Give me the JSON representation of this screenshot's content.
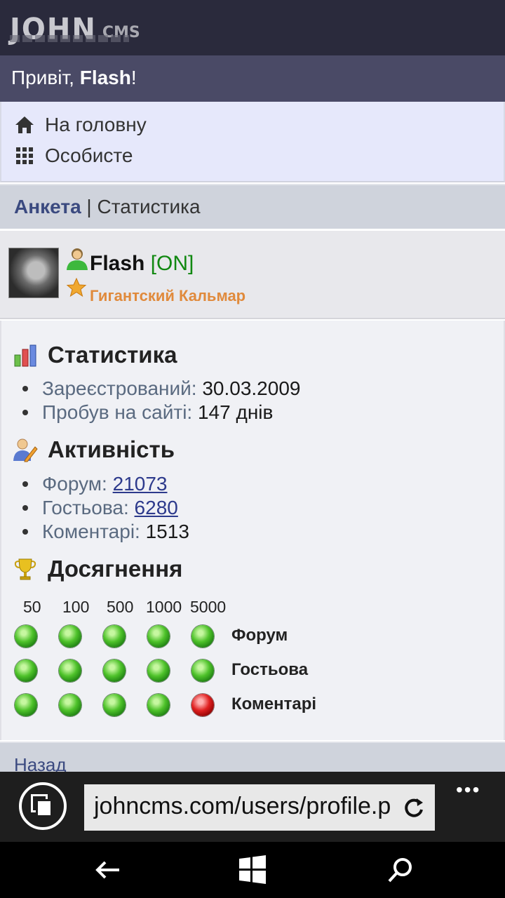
{
  "header": {
    "logo_main": "JOHN",
    "logo_sub": "CMS"
  },
  "greeting": {
    "prefix": "Привіт, ",
    "name": "Flash",
    "suffix": "!"
  },
  "menu": {
    "items": [
      {
        "icon": "home-icon",
        "label": "На головну"
      },
      {
        "icon": "grid-icon",
        "label": "Особисте"
      }
    ]
  },
  "tabs": {
    "active": "Анкета",
    "separator": " | ",
    "other": "Статистика"
  },
  "user": {
    "name": "Flash",
    "status": "[ON]",
    "rank": "Гигантский Кальмар",
    "status_color": "#118811",
    "rank_color": "#e08a3c"
  },
  "statistics": {
    "title": "Статистика",
    "items": [
      {
        "label": "Зареєстрований:",
        "value": "30.03.2009"
      },
      {
        "label": "Пробув на сайті:",
        "value": "147 днів"
      }
    ]
  },
  "activity": {
    "title": "Активність",
    "items": [
      {
        "label": "Форум:",
        "value": "21073",
        "link": true
      },
      {
        "label": "Гостьова:",
        "value": "6280",
        "link": true
      },
      {
        "label": "Коментарі:",
        "value": "1513",
        "link": false
      }
    ]
  },
  "achievements": {
    "title": "Досягнення",
    "thresholds": [
      "50",
      "100",
      "500",
      "1000",
      "5000"
    ],
    "rows": [
      {
        "label": "Форум",
        "status": [
          "green",
          "green",
          "green",
          "green",
          "green"
        ]
      },
      {
        "label": "Гостьова",
        "status": [
          "green",
          "green",
          "green",
          "green",
          "green"
        ]
      },
      {
        "label": "Коментарі",
        "status": [
          "green",
          "green",
          "green",
          "green",
          "red"
        ]
      }
    ]
  },
  "footer": {
    "back_label": "Назад"
  },
  "browser": {
    "url": "johncms.com/users/profile.p",
    "more_label": "•••"
  },
  "colors": {
    "header_bg": "#2a2a3c",
    "greet_bg": "#4a4a66",
    "menu_bg": "#e6e8fb",
    "accent_link": "#2d3a8c"
  }
}
